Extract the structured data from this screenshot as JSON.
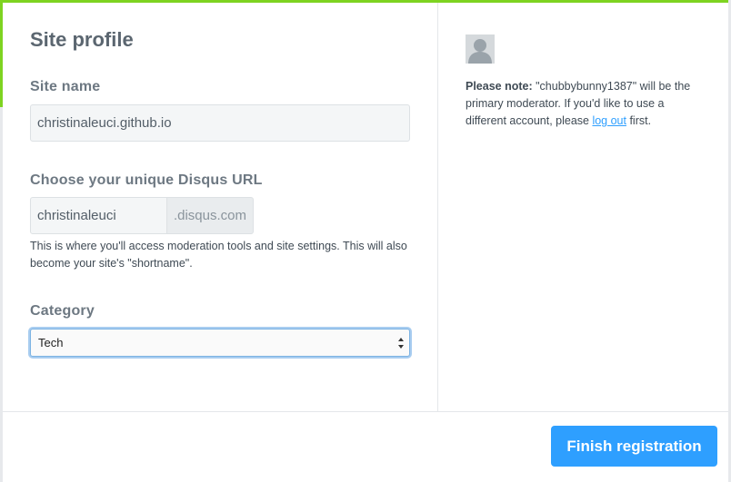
{
  "site_profile": {
    "title": "Site profile",
    "site_name_label": "Site name",
    "site_name_value": "christinaleuci.github.io",
    "url_label": "Choose your unique Disqus URL",
    "url_value": "christinaleuci",
    "url_suffix": ".disqus.com",
    "url_help": "This is where you'll access moderation tools and site settings. This will also become your site's \"shortname\".",
    "category_label": "Category",
    "category_value": "Tech"
  },
  "moderator_note": {
    "lead": "Please note:",
    "text_before_link": " \"chubbybunny1387\" will be the primary moderator. If you'd like to use a different account, please ",
    "link_text": "log out",
    "text_after_link": " first."
  },
  "footer": {
    "finish_button": "Finish registration"
  },
  "colors": {
    "accent_green": "#7ed321",
    "primary_button": "#2e9fff",
    "link": "#2e9fff"
  }
}
